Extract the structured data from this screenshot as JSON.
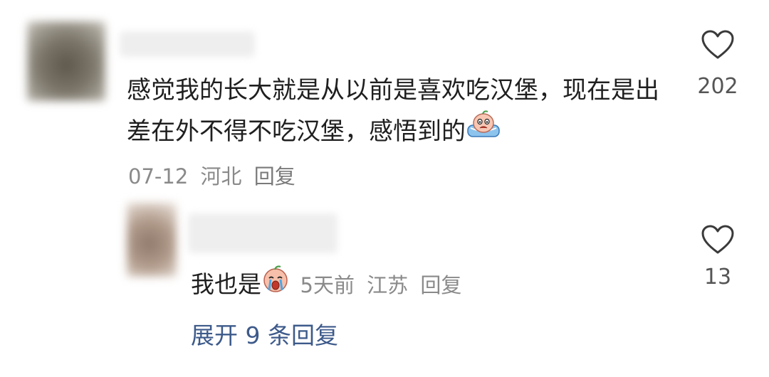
{
  "comment": {
    "text": "感觉我的长大就是从以前是喜欢吃汉堡，现在是出差在外不得不吃汉堡，感悟到的",
    "emoji": "crying-emoji",
    "date": "07-12",
    "location": "河北",
    "reply_label": "回复",
    "likes": "202"
  },
  "reply": {
    "text": "我也是",
    "emoji": "sob-emoji",
    "time": "5天前",
    "location": "江苏",
    "reply_label": "回复",
    "likes": "13"
  },
  "expand_label": "展开 9 条回复",
  "colors": {
    "meta_gray": "#8a8a8a",
    "link_blue": "#3d5a8a",
    "text": "#1f1f1f"
  }
}
